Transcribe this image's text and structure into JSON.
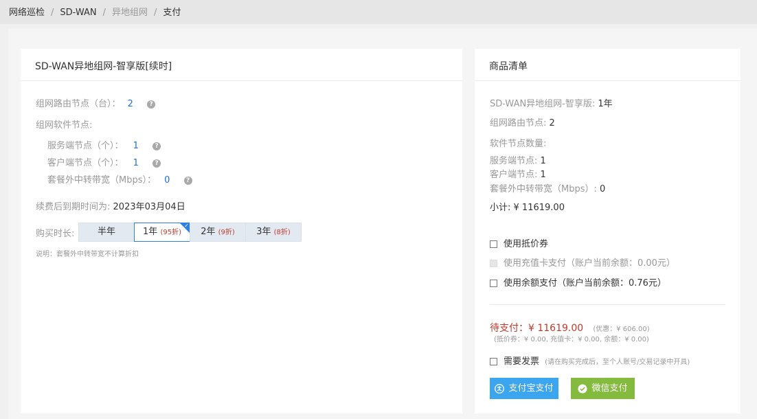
{
  "breadcrumb": [
    "网络巡检",
    "SD-WAN",
    "异地组网",
    "支付"
  ],
  "left": {
    "title": "SD-WAN异地组网-智享版[续时]",
    "router_label": "组网路由节点（台）：",
    "router_value": "2",
    "software_label": "组网软件节点:",
    "server_label": "服务端节点（个）：",
    "server_value": "1",
    "client_label": "客户端节点（个）：",
    "client_value": "1",
    "bandwidth_label": "套餐外中转带宽（Mbps）：",
    "bandwidth_value": "0",
    "expire_label": "续费后到期时间为:",
    "expire_value": "2023年03月04日",
    "duration_label": "购买时长:",
    "durations": [
      {
        "label": "半年",
        "discount": ""
      },
      {
        "label": "1年",
        "discount": "(95折)"
      },
      {
        "label": "2年",
        "discount": "(9折)"
      },
      {
        "label": "3年",
        "discount": "(8折)"
      }
    ],
    "selected_duration": "1年",
    "note": "说明：套餐外中转带宽不计算折扣"
  },
  "right": {
    "title": "商品清单",
    "product_label": "SD-WAN异地组网-智享版:",
    "product_value": "1年",
    "router_label": "组网路由节点:",
    "router_value": "2",
    "software_label": "软件节点数量:",
    "server_label": "服务端节点:",
    "server_value": "1",
    "client_label": "客户端节点:",
    "client_value": "1",
    "bandwidth_label": "套餐外中转带宽（Mbps）:",
    "bandwidth_value": "0",
    "subtotal_label": "小计:",
    "subtotal_value": "¥ 11619.00",
    "coupon_label": "使用抵价券",
    "recharge_label": "使用充值卡支付（账户当前余额：0.00元）",
    "balance_label": "使用余额支付（账户当前余额：0.76元）",
    "pending_label": "待支付：",
    "pending_value": "¥ 11619.00",
    "discount_text": "(优惠：¥ 606.00)",
    "deduct_text": "(抵价券：¥ 0.00, 充值卡：¥ 0.00, 余额：¥ 0.00)",
    "invoice_label": "需要发票",
    "invoice_note": "(请在购买完成后，至个人账号/交易记录中开具)",
    "alipay_label": "支付宝支付",
    "wechat_label": "微信支付"
  },
  "colors": {
    "accent": "#1e6fd9",
    "alipay": "#3ca5f0",
    "wechat": "#84bb3f",
    "price": "#c0392b"
  },
  "icons": [
    "help-icon",
    "checkmark-icon",
    "alipay-icon",
    "wechat-icon"
  ]
}
